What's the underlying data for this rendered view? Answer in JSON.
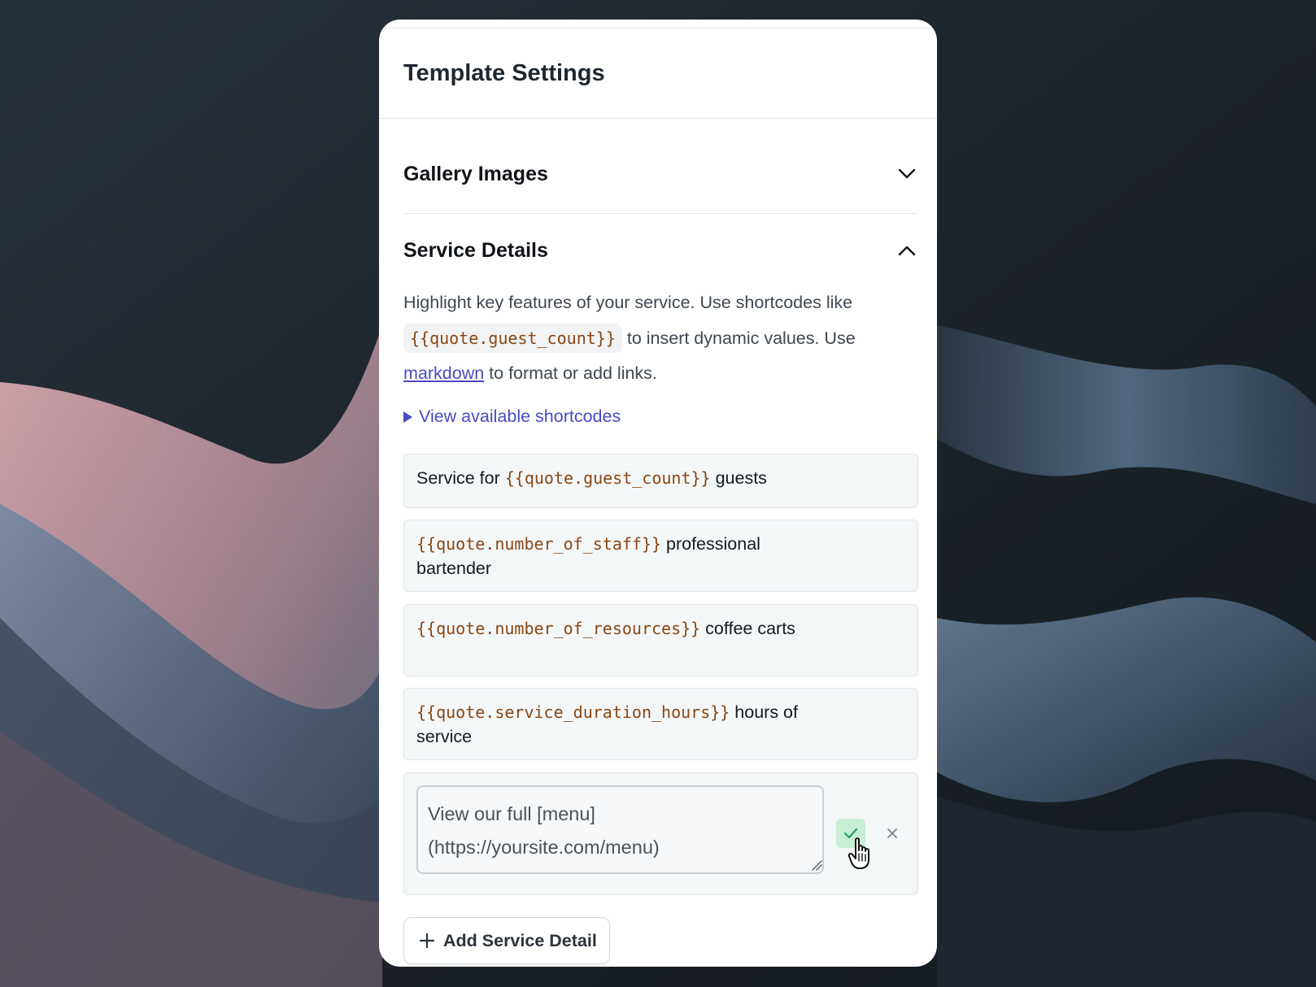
{
  "panel": {
    "title": "Template Settings"
  },
  "sections": {
    "gallery": {
      "title": "Gallery Images",
      "expanded": false,
      "icon": "chevron-down-icon"
    },
    "service": {
      "title": "Service Details",
      "expanded": true,
      "icon": "chevron-up-icon"
    }
  },
  "description": {
    "part1": "Highlight key features of your service. Use shortcodes like ",
    "code": "{{quote.guest_count}}",
    "part2": " to insert dynamic values. Use ",
    "link": "markdown",
    "part3": " to format or add links."
  },
  "shortcodes_toggle": {
    "label": "View available shortcodes",
    "icon": "triangle-right-icon"
  },
  "details": [
    {
      "before": "Service for ",
      "code": "{{quote.guest_count}}",
      "after": " guests"
    },
    {
      "before": "",
      "code": "{{quote.number_of_staff}}",
      "after": " professional bartender"
    },
    {
      "before": "",
      "code": "{{quote.number_of_resources}}",
      "after": " coffee carts"
    },
    {
      "before": "",
      "code": "{{quote.service_duration_hours}}",
      "after": " hours of service"
    }
  ],
  "editing": {
    "value": "View our full [menu](https://yoursite.com/menu)",
    "confirm_icon": "check-icon",
    "cancel_icon": "close-icon"
  },
  "add_button": {
    "label": "Add Service Detail",
    "icon": "plus-icon"
  },
  "colors": {
    "accent_link": "#4a4bc0",
    "code_text": "#8a4614",
    "confirm_bg": "#c8eed5",
    "confirm_check": "#22a35a"
  }
}
